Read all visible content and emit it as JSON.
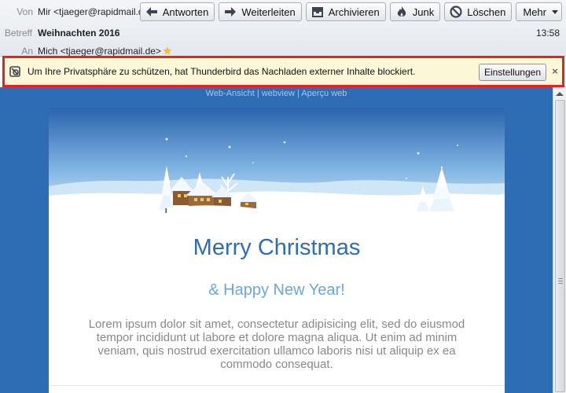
{
  "header": {
    "from_label": "Von",
    "from_value": "Mir <tjaeger@rapidmail.de>",
    "subject_label": "Betreff",
    "subject_value": "Weihnachten 2016",
    "to_label": "An",
    "to_value": "Mich <tjaeger@rapidmail.de>",
    "time": "13:58"
  },
  "toolbar": {
    "reply": "Antworten",
    "forward": "Weiterleiten",
    "archive": "Archivieren",
    "junk": "Junk",
    "delete": "Löschen",
    "more": "Mehr"
  },
  "notification": {
    "text": "Um Ihre Privatsphäre zu schützen, hat Thunderbird das Nachladen externer Inhalte blockiert.",
    "button": "Einstellungen",
    "highlight_color": "#e8211f"
  },
  "email": {
    "web_links": "Web-Ansicht | webview | Aperçu web",
    "title": "Merry Christmas",
    "subtitle": "& Happy New Year!",
    "body": "Lorem ipsum dolor sit amet, consectetur adipisicing elit, sed do eiusmod tempor incididunt ut labore et dolore magna aliqua. Ut enim ad minim veniam, quis nostrud exercitation ullamco laboris nisi ut aliquip ex ea commodo consequat.",
    "background_color": "#2e6db3",
    "title_color": "#2e6db3",
    "subtitle_color": "#6ba6dc"
  },
  "icons": {
    "star": "star-icon",
    "reply": "reply-arrow-icon",
    "forward": "forward-arrow-icon",
    "archive": "archive-box-icon",
    "junk": "junk-flame-icon",
    "delete": "delete-circle-icon",
    "notification": "privacy-shield-icon",
    "close": "close-icon"
  }
}
